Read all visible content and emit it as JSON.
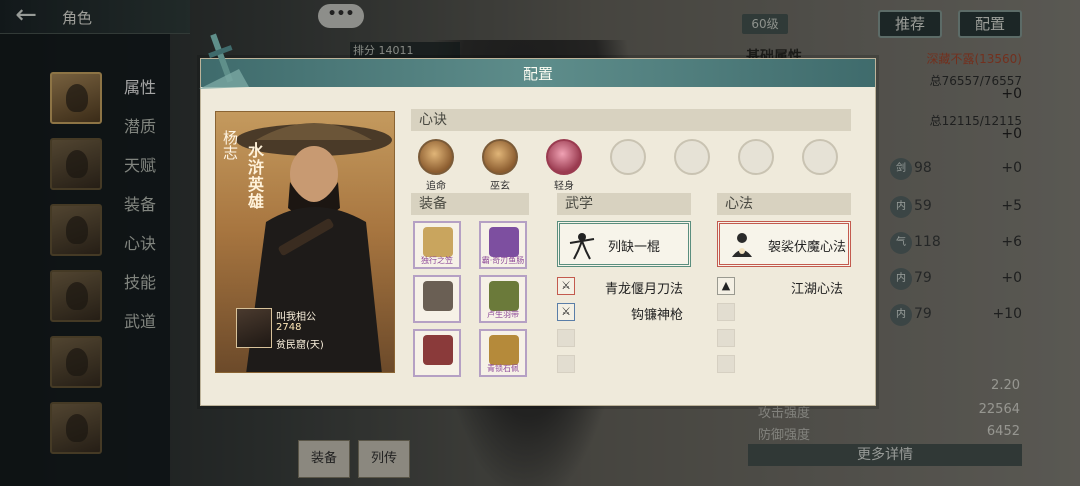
{
  "top_bar": {
    "back_icon": "back-arrow-icon",
    "title": "角色"
  },
  "side_menu": {
    "items": [
      {
        "label": "属性",
        "active": true
      },
      {
        "label": "潜质",
        "active": false
      },
      {
        "label": "天赋",
        "active": false
      },
      {
        "label": "装备",
        "active": false
      },
      {
        "label": "心诀",
        "active": false
      },
      {
        "label": "技能",
        "active": false
      },
      {
        "label": "武道",
        "active": false
      }
    ]
  },
  "chat_bubble": "•••",
  "rank": "排分 14011",
  "level_badge": "60级",
  "buttons": {
    "recommend": "推荐",
    "config": "配置",
    "more_details": "更多详情"
  },
  "right_stats": {
    "title": "基础属性",
    "power": "深藏不露(13560)",
    "hp": "总76557/76557",
    "hp_plus": "+0",
    "mp": "总12115/12115",
    "mp_plus": "+0",
    "attrs": [
      {
        "icon": "剑",
        "value": "98",
        "plus": "+0"
      },
      {
        "icon": "内",
        "value": "59",
        "plus": "+5"
      },
      {
        "icon": "气",
        "value": "118",
        "plus": "+6"
      },
      {
        "icon": "内",
        "value": "79",
        "plus": "+0"
      },
      {
        "icon": "内",
        "value": "79",
        "plus": "+10"
      }
    ],
    "extra": [
      {
        "label": "",
        "value": "2.20"
      },
      {
        "label": "攻击强度",
        "value": "22564"
      },
      {
        "label": "防御强度",
        "value": "6452"
      }
    ]
  },
  "bottom_tags": [
    "装备",
    "列传"
  ],
  "modal": {
    "title": "配置",
    "hero": {
      "name": "杨志",
      "title": "水浒英雄",
      "owner_name": "叫我相公",
      "owner_power": "2748",
      "owner_realm": "贫民窟(天)"
    },
    "sections": {
      "xinjue": "心诀",
      "equip": "装备",
      "wuxue": "武学",
      "xinfa": "心法"
    },
    "skills": [
      {
        "label": "追命",
        "style": "filled"
      },
      {
        "label": "巫玄",
        "style": "filled"
      },
      {
        "label": "轻身",
        "style": "pink"
      },
      {
        "label": "",
        "style": "empty"
      },
      {
        "label": "",
        "style": "empty"
      },
      {
        "label": "",
        "style": "empty"
      },
      {
        "label": "",
        "style": "empty"
      }
    ],
    "equipment": [
      {
        "label": "独行之笠",
        "color": "#c9a55e"
      },
      {
        "label": "霸·奇刃鱼肠",
        "color": "#7d4fa0"
      },
      {
        "label": "",
        "color": "#6a5f54"
      },
      {
        "label": "卢生羽带",
        "color": "#6b7a3a"
      },
      {
        "label": "",
        "color": "#8a3a3a"
      },
      {
        "label": "青锁石佩",
        "color": "#b58a3a"
      }
    ],
    "wuxue": {
      "main": "列缺一棍",
      "subs": [
        "青龙偃月刀法",
        "钩镰神枪"
      ]
    },
    "xinfa": {
      "main": "袈裟伏魔心法",
      "subs": [
        "江湖心法"
      ]
    }
  }
}
